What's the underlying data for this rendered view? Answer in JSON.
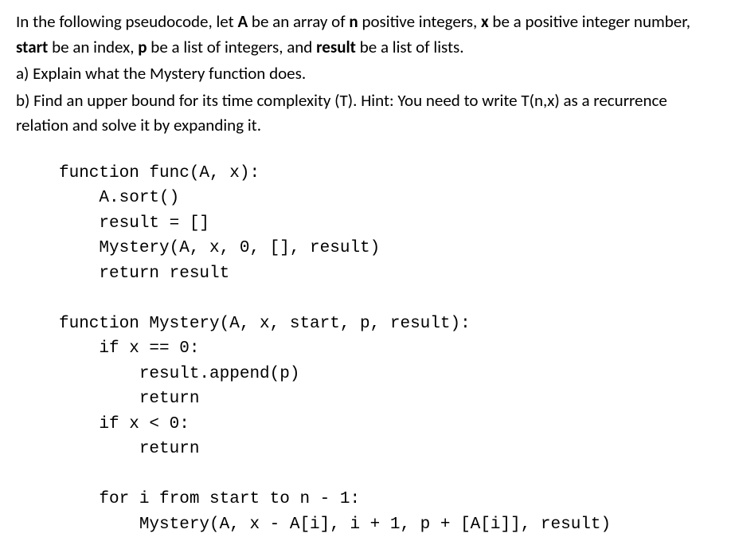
{
  "intro": {
    "pre": " In the following pseudocode, let ",
    "b1": "A",
    "t1": " be an array of ",
    "b2": "n",
    "t2": " positive integers, ",
    "b3": "x",
    "t3": " be a positive integer number, ",
    "b4": "start",
    "t4": " be an index, ",
    "b5": "p",
    "t5": " be a list of integers, and ",
    "b6": "result",
    "t6": " be a list of lists."
  },
  "qa": "a) Explain what the Mystery function does.",
  "qb": "b) Find an upper bound for its time complexity (T). Hint: You need to write T(n,x) as a recurrence relation and solve it by expanding it.",
  "code": "function func(A, x):\n    A.sort()\n    result = []\n    Mystery(A, x, 0, [], result)\n    return result\n\nfunction Mystery(A, x, start, p, result):\n    if x == 0:\n        result.append(p)\n        return\n    if x < 0:\n        return\n\n    for i from start to n - 1:\n        Mystery(A, x - A[i], i + 1, p + [A[i]], result)"
}
